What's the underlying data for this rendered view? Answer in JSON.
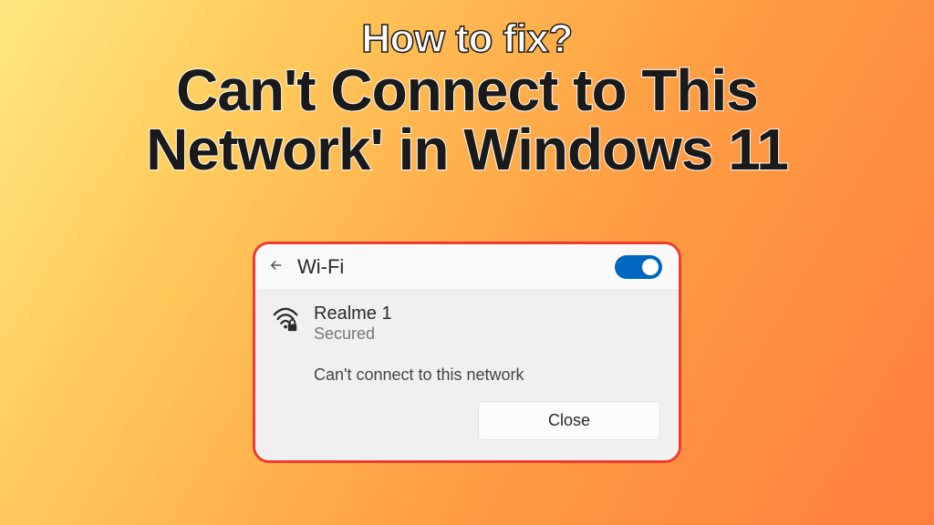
{
  "heading": {
    "line1": "How to fix?",
    "line2a": "Can't Connect to This",
    "line2b": "Network' in Windows 11"
  },
  "panel": {
    "title": "Wi-Fi",
    "toggle_on": true,
    "network": {
      "name": "Realme 1",
      "status": "Secured"
    },
    "error": "Can't connect to this network",
    "close_label": "Close"
  }
}
